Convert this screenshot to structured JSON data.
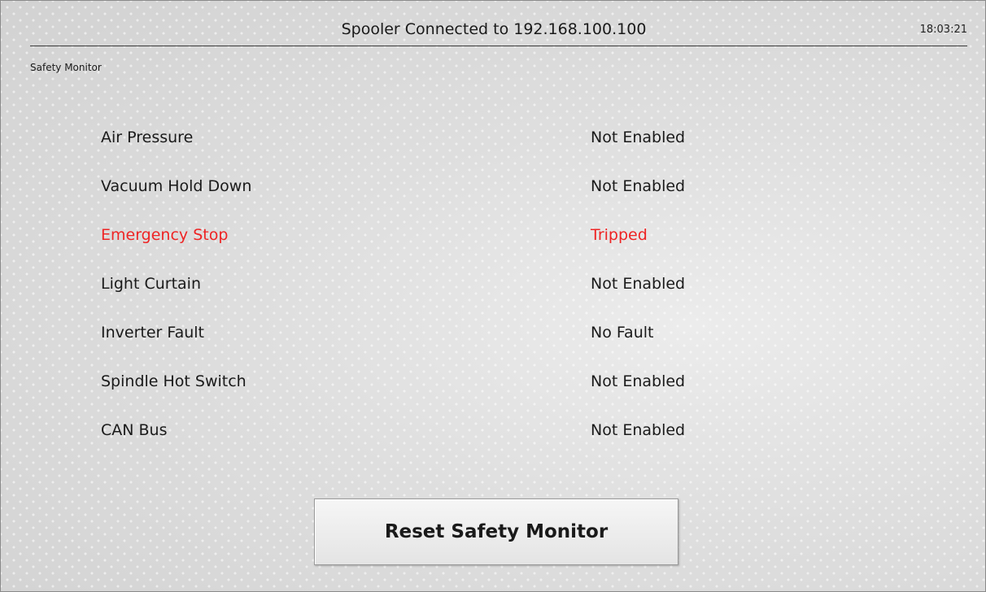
{
  "header": {
    "title": "Spooler Connected to 192.168.100.100",
    "time": "18:03:21"
  },
  "page_label": "Safety Monitor",
  "colors": {
    "alarm": "#ee2424",
    "normal_text": "#1a1a1a"
  },
  "safety_items": [
    {
      "name": "Air Pressure",
      "status": "Not Enabled",
      "alarm": false
    },
    {
      "name": "Vacuum Hold Down",
      "status": "Not Enabled",
      "alarm": false
    },
    {
      "name": "Emergency Stop",
      "status": "Tripped",
      "alarm": true
    },
    {
      "name": "Light Curtain",
      "status": "Not Enabled",
      "alarm": false
    },
    {
      "name": "Inverter Fault",
      "status": "No Fault",
      "alarm": false
    },
    {
      "name": "Spindle Hot Switch",
      "status": "Not Enabled",
      "alarm": false
    },
    {
      "name": "CAN Bus",
      "status": "Not Enabled",
      "alarm": false
    }
  ],
  "actions": {
    "reset_label": "Reset Safety Monitor"
  }
}
